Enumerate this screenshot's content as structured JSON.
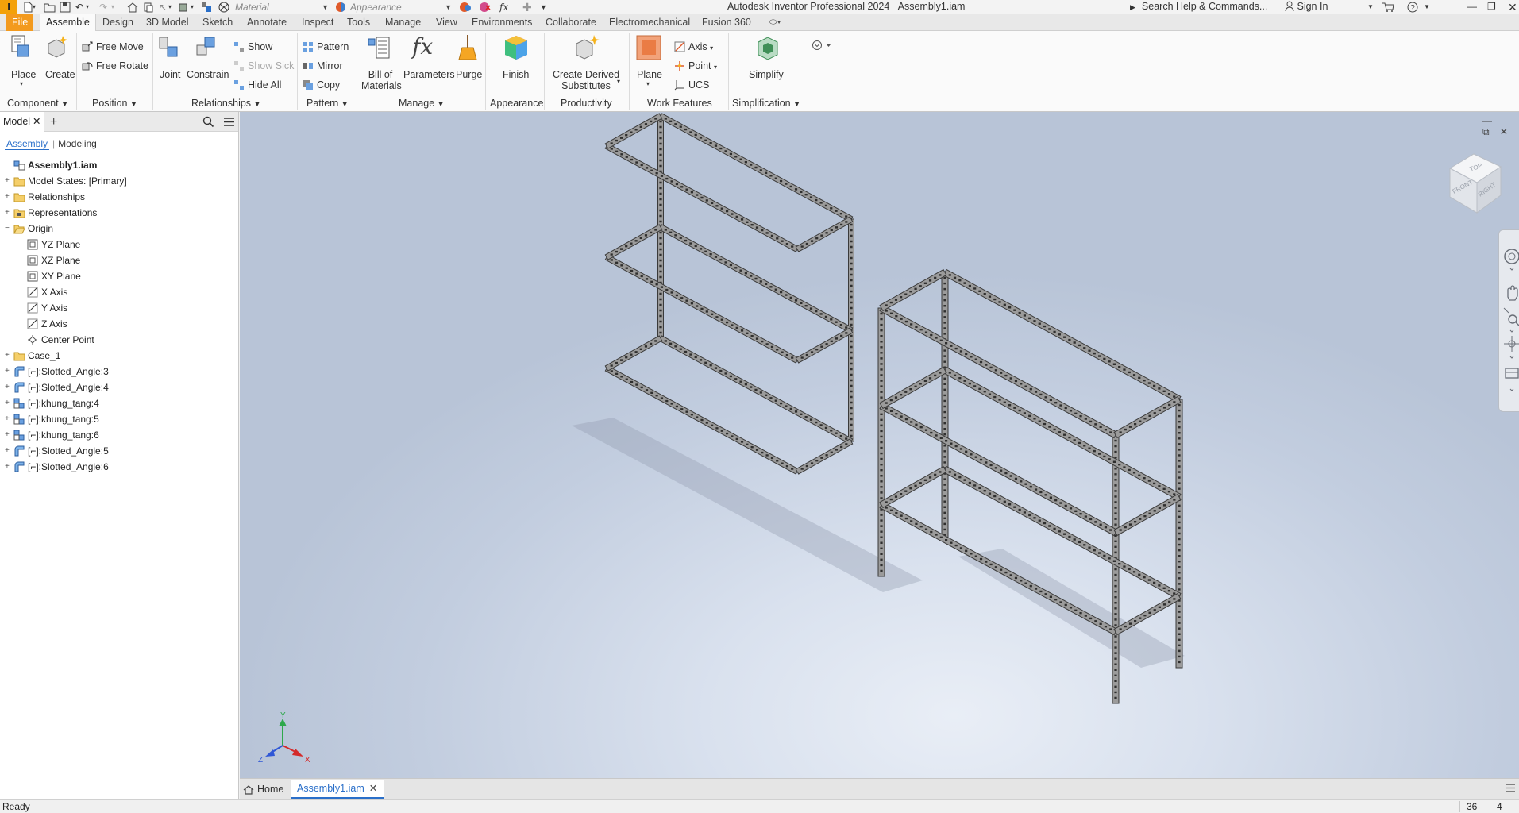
{
  "titlebar": {
    "app_logo": "I",
    "material_combo": "Material",
    "appearance_combo": "Appearance",
    "app_title": "Autodesk Inventor Professional 2024",
    "document_title": "Assembly1.iam",
    "help_search": "Search Help & Commands...",
    "sign_in": "Sign In",
    "help_glyph": "?"
  },
  "ribbon_tabs": [
    "File",
    "Assemble",
    "Design",
    "3D Model",
    "Sketch",
    "Annotate",
    "Inspect",
    "Tools",
    "Manage",
    "View",
    "Environments",
    "Collaborate",
    "Electromechanical",
    "Fusion 360"
  ],
  "ribbon_active_tab": "Assemble",
  "ribbon": {
    "component": {
      "group": "Component",
      "place": "Place",
      "create": "Create"
    },
    "position": {
      "group": "Position",
      "free_move": "Free Move",
      "free_rotate": "Free Rotate"
    },
    "relationships": {
      "group": "Relationships",
      "joint": "Joint",
      "constrain": "Constrain",
      "show": "Show",
      "show_sick": "Show Sick",
      "hide_all": "Hide All"
    },
    "pattern": {
      "group": "Pattern",
      "pattern": "Pattern",
      "mirror": "Mirror",
      "copy": "Copy"
    },
    "manage": {
      "group": "Manage",
      "bom_line1": "Bill of",
      "bom_line2": "Materials",
      "parameters": "Parameters",
      "purge": "Purge"
    },
    "appearance": {
      "group": "Appearance",
      "finish": "Finish"
    },
    "productivity": {
      "group": "Productivity",
      "cds_line1": "Create Derived",
      "cds_line2": "Substitutes"
    },
    "work_features": {
      "group": "Work Features",
      "plane": "Plane",
      "axis": "Axis",
      "point": "Point",
      "ucs": "UCS"
    },
    "simplification": {
      "group": "Simplification",
      "simplify": "Simplify"
    }
  },
  "browser": {
    "tab": "Model",
    "add": "+",
    "view_assembly": "Assembly",
    "view_modeling": "Modeling",
    "tree": [
      {
        "label": "Assembly1.iam",
        "icon": "assembly-icon",
        "level": 0,
        "expander": "",
        "root": true
      },
      {
        "label": "Model States: [Primary]",
        "icon": "folder-icon",
        "level": 0,
        "expander": "+"
      },
      {
        "label": "Relationships",
        "icon": "folder-icon",
        "level": 0,
        "expander": "+"
      },
      {
        "label": "Representations",
        "icon": "representations-icon",
        "level": 0,
        "expander": "+"
      },
      {
        "label": "Origin",
        "icon": "folder-open-icon",
        "level": 0,
        "expander": "−"
      },
      {
        "label": "YZ Plane",
        "icon": "plane-icon",
        "level": 1,
        "expander": ""
      },
      {
        "label": "XZ Plane",
        "icon": "plane-icon",
        "level": 1,
        "expander": "+"
      },
      {
        "label": "XY Plane",
        "icon": "plane-icon",
        "level": 1,
        "expander": ""
      },
      {
        "label": "X Axis",
        "icon": "axis-icon",
        "level": 1,
        "expander": ""
      },
      {
        "label": "Y Axis",
        "icon": "axis-icon",
        "level": 1,
        "expander": ""
      },
      {
        "label": "Z Axis",
        "icon": "axis-icon",
        "level": 1,
        "expander": ""
      },
      {
        "label": "Center Point",
        "icon": "point-icon",
        "level": 1,
        "expander": ""
      },
      {
        "label": "Case_1",
        "icon": "folder-icon",
        "level": 0,
        "expander": "+"
      },
      {
        "label": "[⌐]:Slotted_Angle:3",
        "icon": "part-icon",
        "level": 0,
        "expander": "+"
      },
      {
        "label": "[⌐]:Slotted_Angle:4",
        "icon": "part-icon",
        "level": 0,
        "expander": "+"
      },
      {
        "label": "[⌐]:khung_tang:4",
        "icon": "subassembly-icon",
        "level": 0,
        "expander": "+"
      },
      {
        "label": "[⌐]:khung_tang:5",
        "icon": "subassembly-icon",
        "level": 0,
        "expander": "+"
      },
      {
        "label": "[⌐]:khung_tang:6",
        "icon": "subassembly-icon",
        "level": 0,
        "expander": "+"
      },
      {
        "label": "[⌐]:Slotted_Angle:5",
        "icon": "part-icon",
        "level": 0,
        "expander": "+"
      },
      {
        "label": "[⌐]:Slotted_Angle:6",
        "icon": "part-icon",
        "level": 0,
        "expander": "+"
      }
    ]
  },
  "viewcube": {
    "top": "TOP",
    "front": "FRONT",
    "right": "RIGHT"
  },
  "triad": {
    "x": "X",
    "y": "Y",
    "z": "Z"
  },
  "doc_tabs": {
    "home": "Home",
    "document": "Assembly1.iam"
  },
  "status": {
    "text": "Ready",
    "count1": "36",
    "count2": "4"
  },
  "colors": {
    "file_tab": "#f39a1e",
    "accent": "#2a6fc9",
    "logo": "#f3a10a"
  }
}
